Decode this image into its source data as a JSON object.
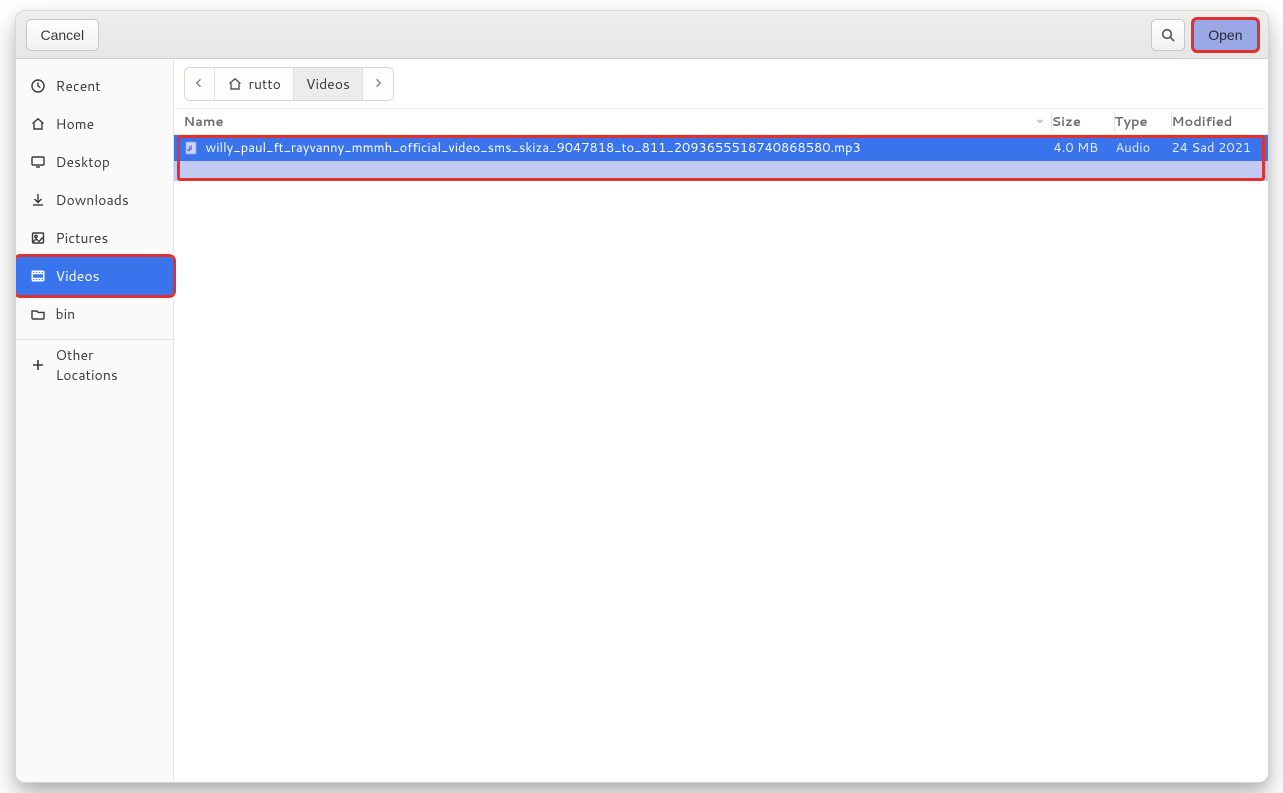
{
  "header": {
    "cancel_label": "Cancel",
    "open_label": "Open"
  },
  "sidebar": {
    "items": [
      {
        "id": "recent",
        "label": "Recent",
        "icon": "clock"
      },
      {
        "id": "home",
        "label": "Home",
        "icon": "home"
      },
      {
        "id": "desktop",
        "label": "Desktop",
        "icon": "desktop"
      },
      {
        "id": "downloads",
        "label": "Downloads",
        "icon": "download"
      },
      {
        "id": "pictures",
        "label": "Pictures",
        "icon": "picture"
      },
      {
        "id": "videos",
        "label": "Videos",
        "icon": "video",
        "selected": true
      },
      {
        "id": "bin",
        "label": "bin",
        "icon": "folder"
      }
    ],
    "other_locations_label": "Other Locations"
  },
  "pathbar": {
    "segments": [
      {
        "id": "home-seg",
        "label": "rutto",
        "icon": "home"
      },
      {
        "id": "videos-seg",
        "label": "Videos",
        "current": true
      }
    ]
  },
  "list": {
    "columns": {
      "name": "Name",
      "size": "Size",
      "type": "Type",
      "modified": "Modified"
    },
    "rows": [
      {
        "name": "willy_paul_ft_rayvanny_mmmh_official_video_sms_skiza_9047818_to_811_2093655518740868580.mp3",
        "size": "4.0 MB",
        "type": "Audio",
        "modified": "24 Sad 2021",
        "selected": true
      }
    ]
  }
}
